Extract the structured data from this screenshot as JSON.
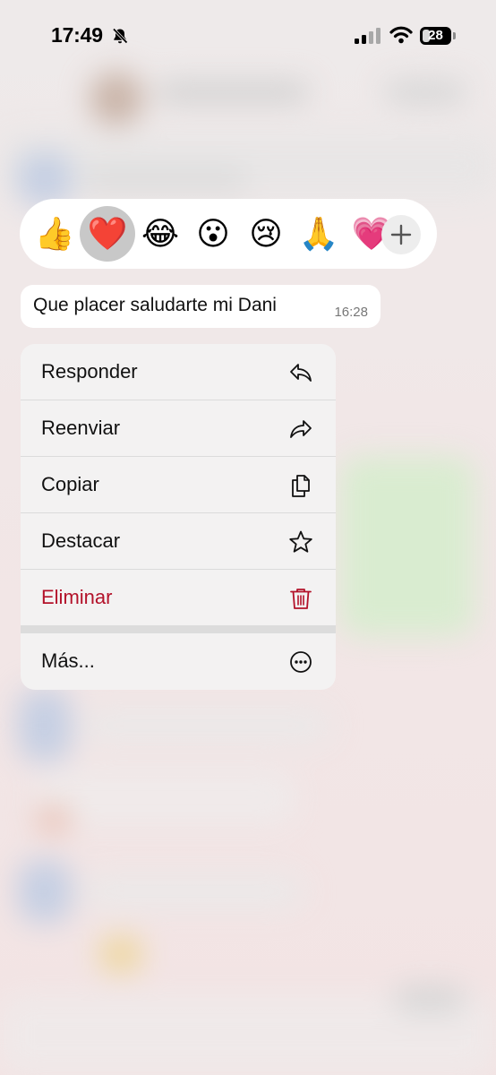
{
  "status_bar": {
    "time": "17:49",
    "battery": "28",
    "battery_level": 0.28
  },
  "reactions": [
    {
      "emoji": "👍",
      "name": "thumbs-up",
      "selected": false
    },
    {
      "emoji": "❤️",
      "name": "red-heart",
      "selected": true
    },
    {
      "emoji": "😂",
      "name": "tears-of-joy",
      "selected": false
    },
    {
      "emoji": "😮",
      "name": "surprised",
      "selected": false
    },
    {
      "emoji": "😢",
      "name": "crying",
      "selected": false
    },
    {
      "emoji": "🙏",
      "name": "folded-hands",
      "selected": false
    },
    {
      "emoji": "💗",
      "name": "pink-heart",
      "selected": false
    }
  ],
  "add_reaction_icon": "plus-icon",
  "message": {
    "text": "Que placer saludarte mi Dani",
    "time": "16:28"
  },
  "menu": {
    "items": [
      {
        "label": "Responder",
        "icon": "reply-icon"
      },
      {
        "label": "Reenviar",
        "icon": "forward-icon"
      },
      {
        "label": "Copiar",
        "icon": "copy-icon"
      },
      {
        "label": "Destacar",
        "icon": "star-icon"
      },
      {
        "label": "Eliminar",
        "icon": "trash-icon",
        "color": "#b3122a"
      },
      {
        "label": "Más...",
        "icon": "more-icon"
      }
    ]
  }
}
